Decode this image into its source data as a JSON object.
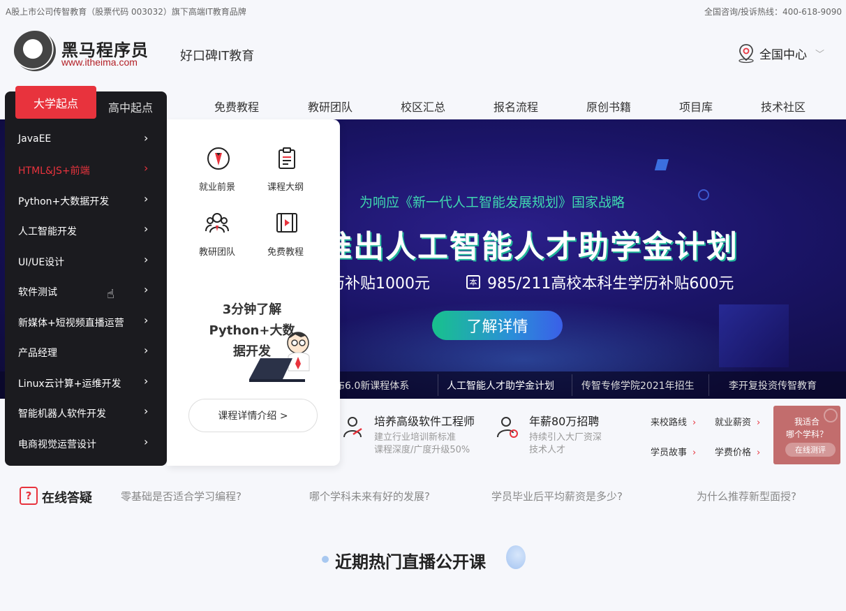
{
  "topbar": {
    "left": "A股上市公司传智教育（股票代码 003032）旗下高端IT教育品牌",
    "right": "全国咨询/投诉热线：400-618-9090"
  },
  "header": {
    "logo_cn": "黑马程序员",
    "logo_en": "www.itheima.com",
    "slogan": "好口碑IT教育",
    "center": "全国中心"
  },
  "nav": {
    "items": [
      "免费教程",
      "教研团队",
      "校区汇总",
      "报名流程",
      "原创书籍",
      "项目库",
      "技术社区"
    ]
  },
  "menu": {
    "tab_active": "大学起点",
    "tab_other": "高中起点",
    "items": [
      "JavaEE",
      "HTML&JS+前端",
      "Python+大数据开发",
      "人工智能开发",
      "UI/UE设计",
      "软件测试",
      "新媒体+短视频直播运营",
      "产品经理",
      "Linux云计算+运维开发",
      "智能机器人软件开发",
      "电商视觉运营设计"
    ],
    "active_index": 1
  },
  "popover": {
    "links": [
      "就业前景",
      "课程大纲",
      "教研团队",
      "免费教程"
    ],
    "question": "3分钟了解Python+大数据开发",
    "button": "课程详情介绍 >"
  },
  "banner": {
    "subtitle": "为响应《新一代人工智能发展规划》国家战略",
    "title": "推出人工智能人才助学金计划",
    "line1": "历补贴1000元",
    "line2_icon": "本",
    "line2": "985/211高校本科生学历补贴600元",
    "button": "了解详情",
    "tabs": [
      "布6.0新课程体系",
      "人工智能人才助学金计划",
      "传智专修学院2021年招生",
      "李开复投资传智教育"
    ],
    "active_tab": 1
  },
  "features": [
    {
      "title": "培养高级软件工程师",
      "desc1": "建立行业培训新标准",
      "desc2": "课程深度/广度升级50%"
    },
    {
      "title": "年薪80万招聘",
      "desc1": "持续引入大厂资深",
      "desc2": "技术人才"
    }
  ],
  "quick_links": [
    "来校路线",
    "就业薪资",
    "学员故事",
    "学费价格"
  ],
  "quiz": {
    "line1": "我适合",
    "line2": "哪个学科？",
    "button": "在线测评"
  },
  "qa": {
    "icon": "?",
    "title": "在线答疑",
    "questions": [
      "零基础是否适合学习编程?",
      "哪个学科未来有好的发展?",
      "学员毕业后平均薪资是多少?",
      "为什么推荐新型面授?"
    ]
  },
  "section": {
    "title": "近期热门直播公开课"
  },
  "colors": {
    "accent": "#e8333d",
    "menu_bg": "#1b1b1f",
    "banner_bg": "#1a1466",
    "teal": "#3fd7b0"
  }
}
